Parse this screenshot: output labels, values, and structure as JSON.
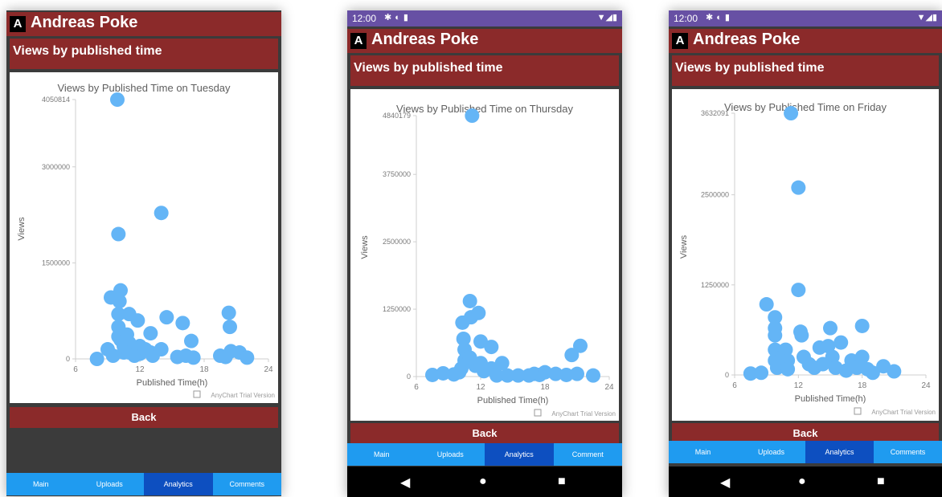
{
  "app_name": "Andreas Poke",
  "section_title": "Views by published time",
  "back_label": "Back",
  "status_time": "12:00",
  "nav_labels_full": [
    "Main",
    "Uploads",
    "Analytics",
    "Comments"
  ],
  "nav_labels_cut": [
    "Main",
    "Uploads",
    "Analytics",
    "Comment"
  ],
  "active_tab": "Analytics",
  "colors": {
    "header": "#8b2a2a",
    "frame": "#3b3b3b",
    "nav": "#1f9bf0",
    "nav_active": "#0d4fc0",
    "status": "#6750a4",
    "marker": "#64b5f6"
  },
  "icons": [
    "app-logo-icon",
    "settings-icon",
    "sync-icon",
    "sd-card-icon",
    "wifi-icon",
    "signal-icon",
    "battery-icon",
    "back-nav-icon",
    "home-nav-icon",
    "recents-nav-icon",
    "anychart-icon"
  ],
  "chart_data": [
    {
      "type": "scatter",
      "title": "Views by Published Time on Tuesday",
      "xlabel": "Published Time(h)",
      "ylabel": "Views",
      "watermark": "AnyChart Trial Version",
      "xlim": [
        6,
        24
      ],
      "ylim": [
        0,
        4050814
      ],
      "xticks": [
        6,
        12,
        18,
        24
      ],
      "yticks": [
        "0",
        "1500000",
        "3000000",
        "4050814"
      ],
      "points": [
        [
          8,
          0
        ],
        [
          9,
          150000
        ],
        [
          9.5,
          50000
        ],
        [
          9.3,
          960000
        ],
        [
          9.9,
          4050000
        ],
        [
          10,
          1950000
        ],
        [
          10.2,
          1070000
        ],
        [
          10.1,
          900000
        ],
        [
          10,
          700000
        ],
        [
          10,
          500000
        ],
        [
          10,
          350000
        ],
        [
          10.2,
          300000
        ],
        [
          10.5,
          200000
        ],
        [
          10.5,
          100000
        ],
        [
          10.8,
          380000
        ],
        [
          11,
          700000
        ],
        [
          11,
          250000
        ],
        [
          11,
          100000
        ],
        [
          11.5,
          50000
        ],
        [
          11.8,
          600000
        ],
        [
          12,
          200000
        ],
        [
          12,
          80000
        ],
        [
          12.5,
          150000
        ],
        [
          13,
          100000
        ],
        [
          13,
          400000
        ],
        [
          13.2,
          50000
        ],
        [
          14,
          2280000
        ],
        [
          14,
          150000
        ],
        [
          14.5,
          650000
        ],
        [
          15.5,
          30000
        ],
        [
          16,
          560000
        ],
        [
          16.3,
          50000
        ],
        [
          16.8,
          280000
        ],
        [
          17,
          20000
        ],
        [
          19.5,
          50000
        ],
        [
          20,
          30000
        ],
        [
          20.3,
          720000
        ],
        [
          20.4,
          500000
        ],
        [
          20.5,
          120000
        ],
        [
          21.3,
          100000
        ],
        [
          22,
          20000
        ]
      ]
    },
    {
      "type": "scatter",
      "title": "Views by Published Time on Thursday",
      "xlabel": "Published Time(h)",
      "ylabel": "Views",
      "watermark": "AnyChart Trial Version",
      "xlim": [
        6,
        24
      ],
      "ylim": [
        0,
        4840179
      ],
      "xticks": [
        6,
        12,
        18,
        24
      ],
      "yticks": [
        "0",
        "1250000",
        "2500000",
        "3750000",
        "4840179"
      ],
      "points": [
        [
          7.5,
          30000
        ],
        [
          8.5,
          60000
        ],
        [
          9.5,
          40000
        ],
        [
          10,
          80000
        ],
        [
          10.2,
          150000
        ],
        [
          10.3,
          1000000
        ],
        [
          10.4,
          700000
        ],
        [
          10.5,
          500000
        ],
        [
          10.5,
          300000
        ],
        [
          11,
          1400000
        ],
        [
          11.1,
          1100000
        ],
        [
          11,
          350000
        ],
        [
          11.2,
          4840000
        ],
        [
          11.5,
          200000
        ],
        [
          11.8,
          1180000
        ],
        [
          12,
          650000
        ],
        [
          12,
          250000
        ],
        [
          12.3,
          100000
        ],
        [
          13,
          550000
        ],
        [
          13,
          150000
        ],
        [
          13.5,
          20000
        ],
        [
          14,
          250000
        ],
        [
          14.5,
          20000
        ],
        [
          15.5,
          20000
        ],
        [
          16.5,
          20000
        ],
        [
          17,
          50000
        ],
        [
          17.5,
          30000
        ],
        [
          18,
          80000
        ],
        [
          19,
          50000
        ],
        [
          20,
          30000
        ],
        [
          20.5,
          400000
        ],
        [
          21,
          50000
        ],
        [
          21.3,
          570000
        ],
        [
          22.5,
          20000
        ]
      ]
    },
    {
      "type": "scatter",
      "title": "Views by Published Time on Friday",
      "xlabel": "Published Time(h)",
      "ylabel": "Views",
      "watermark": "AnyChart Trial Version",
      "xlim": [
        6,
        24
      ],
      "ylim": [
        0,
        3632091
      ],
      "xticks": [
        6,
        12,
        18,
        24
      ],
      "yticks": [
        "0",
        "1250000",
        "2500000",
        "3632091"
      ],
      "points": [
        [
          7.5,
          20000
        ],
        [
          8.5,
          30000
        ],
        [
          9,
          980000
        ],
        [
          9.8,
          800000
        ],
        [
          9.8,
          650000
        ],
        [
          9.8,
          550000
        ],
        [
          9.8,
          350000
        ],
        [
          9.8,
          200000
        ],
        [
          10,
          100000
        ],
        [
          10.5,
          250000
        ],
        [
          10.8,
          350000
        ],
        [
          11,
          200000
        ],
        [
          11,
          80000
        ],
        [
          11.3,
          3632000
        ],
        [
          12,
          2600000
        ],
        [
          12,
          1180000
        ],
        [
          12.2,
          600000
        ],
        [
          12.3,
          550000
        ],
        [
          12.5,
          250000
        ],
        [
          13,
          150000
        ],
        [
          13.5,
          100000
        ],
        [
          14,
          380000
        ],
        [
          14.3,
          150000
        ],
        [
          14.8,
          400000
        ],
        [
          15,
          650000
        ],
        [
          15.2,
          250000
        ],
        [
          15.5,
          100000
        ],
        [
          16,
          450000
        ],
        [
          16.5,
          60000
        ],
        [
          17,
          200000
        ],
        [
          17.5,
          100000
        ],
        [
          18,
          680000
        ],
        [
          18,
          250000
        ],
        [
          18.5,
          80000
        ],
        [
          19,
          30000
        ],
        [
          20,
          120000
        ],
        [
          21,
          50000
        ]
      ]
    }
  ]
}
